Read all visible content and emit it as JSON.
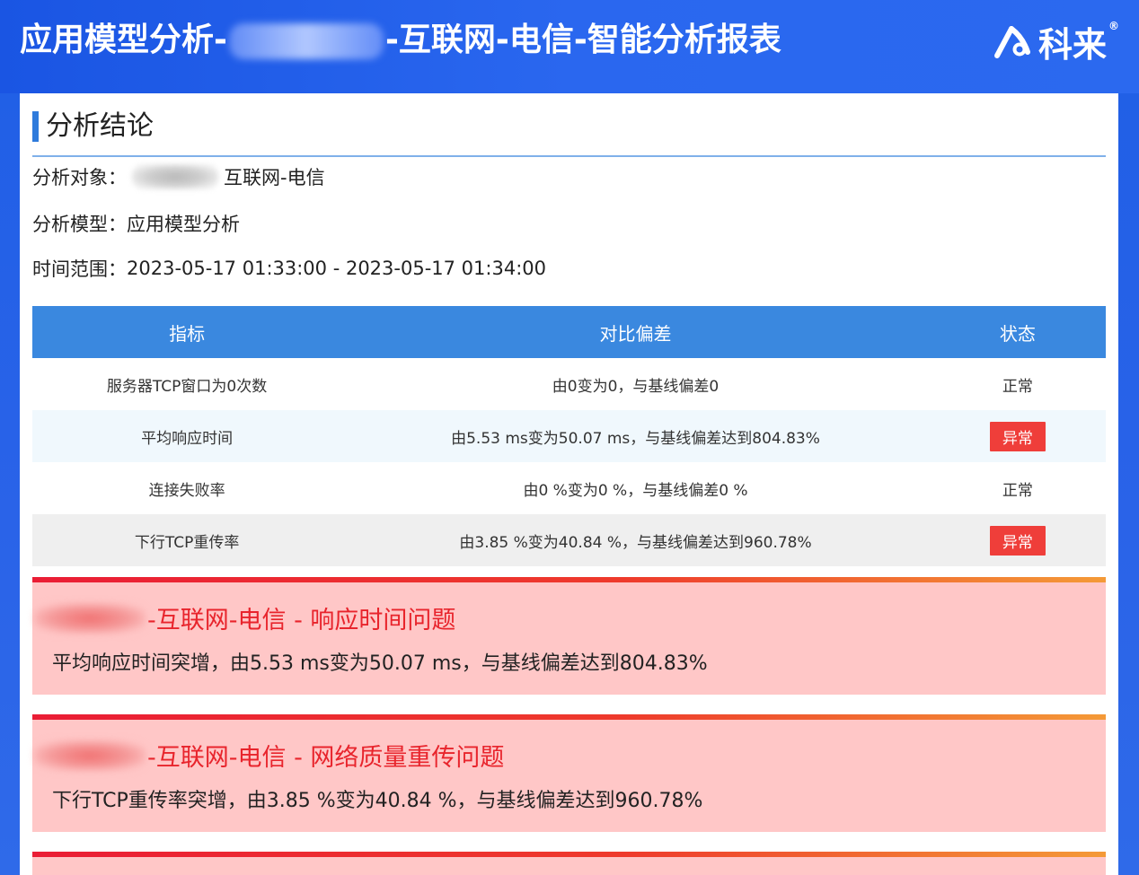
{
  "header": {
    "title_prefix": "应用模型分析-",
    "title_suffix": "-互联网-电信-智能分析报表",
    "brand": "科来"
  },
  "conclusion": {
    "section_title": "分析结论",
    "object_label": "分析对象：",
    "object_value": "互联网-电信",
    "model_label": "分析模型：",
    "model_value": "应用模型分析",
    "time_label": "时间范围：",
    "time_value": "2023-05-17 01:33:00 - 2023-05-17 01:34:00"
  },
  "table": {
    "headers": [
      "指标",
      "对比偏差",
      "状态"
    ],
    "rows": [
      {
        "metric": "服务器TCP窗口为0次数",
        "deviation": "由0变为0，与基线偏差0",
        "status": "正常"
      },
      {
        "metric": "平均响应时间",
        "deviation": "由5.53 ms变为50.07 ms，与基线偏差达到804.83%",
        "status": "异常"
      },
      {
        "metric": "连接失败率",
        "deviation": "由0 %变为0 %，与基线偏差0 %",
        "status": "正常"
      },
      {
        "metric": "下行TCP重传率",
        "deviation": "由3.85 %变为40.84 %，与基线偏差达到960.78%",
        "status": "异常"
      }
    ]
  },
  "alerts": [
    {
      "title": "-互联网-电信 - 响应时间问题",
      "desc": "平均响应时间突增，由5.53 ms变为50.07 ms，与基线偏差达到804.83%"
    },
    {
      "title": "-互联网-电信 - 网络质量重传问题",
      "desc": "下行TCP重传率突增，由3.85 %变为40.84 %，与基线偏差达到960.78%"
    }
  ],
  "colors": {
    "header_blue": "#1f5fe6",
    "table_header": "#3a88df",
    "bad_status": "#ef3e3a",
    "alert_bg": "#ffc7c7",
    "alert_title": "#e8242c"
  }
}
